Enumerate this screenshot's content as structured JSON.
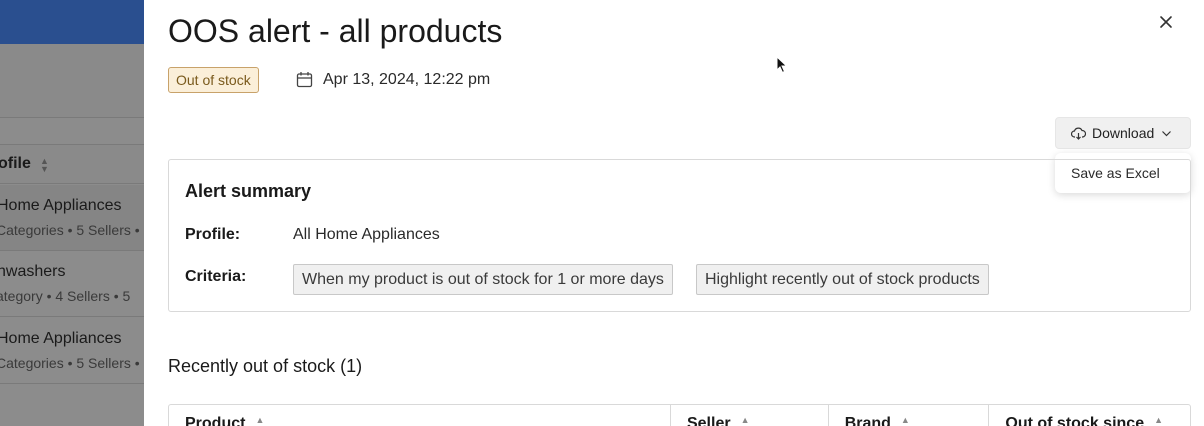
{
  "background": {
    "column_header": "ofile",
    "rows": [
      {
        "name": "Home Appliances",
        "meta": "Categories • 5 Sellers •"
      },
      {
        "name": "hwashers",
        "meta": "ategory • 4 Sellers • 5"
      },
      {
        "name": "Home Appliances",
        "meta": "Categories • 5 Sellers •"
      }
    ]
  },
  "drawer": {
    "title": "OOS alert - all products",
    "status_badge": "Out of stock",
    "date": "Apr 13, 2024, 12:22 pm",
    "download": {
      "label": "Download",
      "menu_items": [
        "Save as Excel"
      ]
    },
    "summary": {
      "title": "Alert summary",
      "profile_label": "Profile:",
      "profile_value": "All Home Appliances",
      "criteria_label": "Criteria:",
      "criteria_tags": [
        "When my product is out of stock for 1 or more days",
        "Highlight recently out of stock products"
      ]
    },
    "section_title": "Recently out of stock (1)",
    "table": {
      "columns": [
        "Product",
        "Seller",
        "Brand",
        "Out of stock since"
      ]
    }
  },
  "colors": {
    "header_blue": "#2a4f8f",
    "badge_bg": "#fbefd9",
    "badge_border": "#c8a26a"
  },
  "icons": [
    "close-icon",
    "calendar-icon",
    "cloud-download-icon",
    "chevron-down-icon",
    "sort-icon",
    "mouse-cursor-icon"
  ]
}
